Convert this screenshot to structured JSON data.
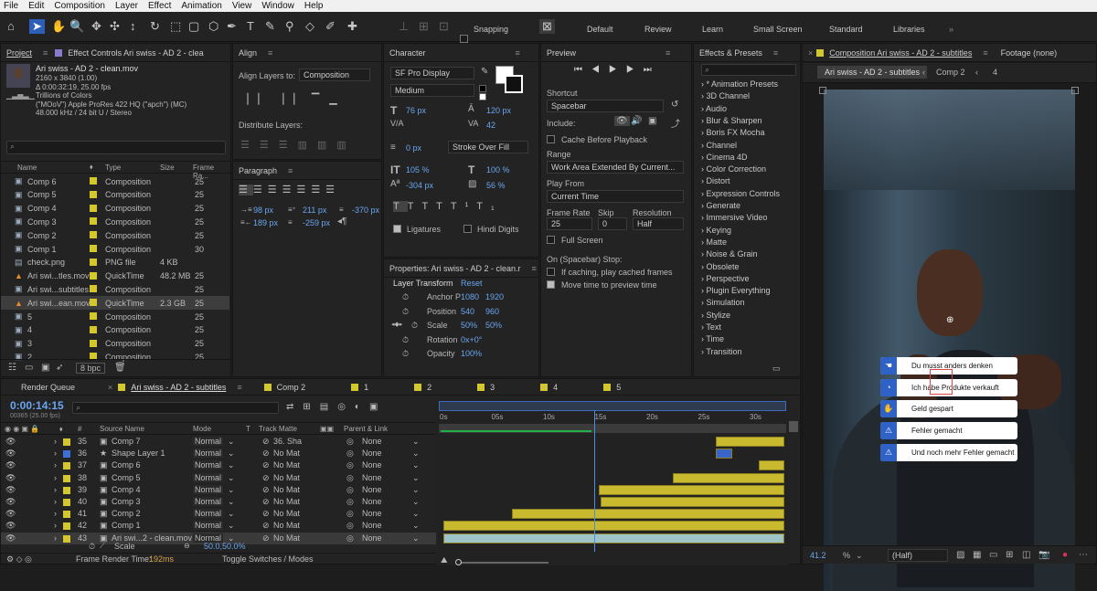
{
  "menu": [
    "File",
    "Edit",
    "Composition",
    "Layer",
    "Effect",
    "Animation",
    "View",
    "Window",
    "Help"
  ],
  "toolbar": {
    "snapping": "Snapping",
    "workspaces": [
      "Default",
      "Review",
      "Learn",
      "Small Screen",
      "Standard",
      "Libraries"
    ]
  },
  "project": {
    "tab": "Project",
    "tab2": "Effect Controls Ari swiss - AD 2 - clea",
    "file_name": "Ari swiss - AD 2 - clean.mov",
    "file_info": [
      "2160 x 3840 (1.00)",
      "Δ 0:00:32:19, 25.00 fps",
      "Trillions of Colors",
      "(\"MOoV\") Apple ProRes 422 HQ (\"apch\") (MC)",
      "48.000 kHz / 24 bit U / Stereo"
    ],
    "search_placeholder": "⌕",
    "headers": [
      "Name",
      "Type",
      "Size",
      "Frame Ra..."
    ],
    "rows": [
      {
        "name": "Comp 6",
        "type": "Composition",
        "size": "",
        "fr": "25"
      },
      {
        "name": "Comp 5",
        "type": "Composition",
        "size": "",
        "fr": "25"
      },
      {
        "name": "Comp 4",
        "type": "Composition",
        "size": "",
        "fr": "25"
      },
      {
        "name": "Comp 3",
        "type": "Composition",
        "size": "",
        "fr": "25"
      },
      {
        "name": "Comp 2",
        "type": "Composition",
        "size": "",
        "fr": "25"
      },
      {
        "name": "Comp 1",
        "type": "Composition",
        "size": "",
        "fr": "30"
      },
      {
        "name": "check.png",
        "type": "PNG file",
        "size": "4 KB",
        "fr": ""
      },
      {
        "name": "Ari swi...tles.mov",
        "type": "QuickTime",
        "size": "48.2 MB",
        "fr": "25"
      },
      {
        "name": "Ari swi...subtitles",
        "type": "Composition",
        "size": "",
        "fr": "25"
      },
      {
        "name": "Ari swi...ean.mov",
        "type": "QuickTime",
        "size": "2.3 GB",
        "fr": "25"
      },
      {
        "name": "5",
        "type": "Composition",
        "size": "",
        "fr": "25"
      },
      {
        "name": "4",
        "type": "Composition",
        "size": "",
        "fr": "25"
      },
      {
        "name": "3",
        "type": "Composition",
        "size": "",
        "fr": "25"
      },
      {
        "name": "2",
        "type": "Composition",
        "size": "",
        "fr": "25"
      }
    ],
    "bpc": "8 bpc"
  },
  "align": {
    "title": "Align",
    "align_to_label": "Align Layers to:",
    "align_to": "Composition",
    "distribute": "Distribute Layers:"
  },
  "paragraph": {
    "title": "Paragraph",
    "v1": "98 px",
    "v2": "211 px",
    "v3": "-370 px",
    "v4": "189 px",
    "v5": "-259 px"
  },
  "character": {
    "title": "Character",
    "font": "SF Pro Display",
    "style": "Medium",
    "size": "76 px",
    "leading": "120 px",
    "kerning": "",
    "tracking": "42",
    "stroke": "0 px",
    "stroke_mode": "Stroke Over Fill",
    "vscale": "105 %",
    "hscale": "100 %",
    "baseline": "-304 px",
    "tsume": "56 %",
    "ligatures": "Ligatures",
    "hindi": "Hindi Digits"
  },
  "properties": {
    "title": "Properties: Ari swiss - AD 2 - clean.r",
    "section": "Layer Transform",
    "reset": "Reset",
    "anchor_label": "Anchor P",
    "anchor": [
      "1080",
      "1920"
    ],
    "position_label": "Position",
    "position": [
      "540",
      "960"
    ],
    "scale_label": "Scale",
    "scale": [
      "50%",
      "50%"
    ],
    "rotation_label": "Rotation",
    "rotation": "0x+0°",
    "opacity_label": "Opacity",
    "opacity": "100%"
  },
  "preview": {
    "title": "Preview",
    "shortcut_label": "Shortcut",
    "shortcut": "Spacebar",
    "include": "Include:",
    "cache": "Cache Before Playback",
    "range_label": "Range",
    "range": "Work Area Extended By Current...",
    "play_from_label": "Play From",
    "play_from": "Current Time",
    "fr_label": "Frame Rate",
    "skip_label": "Skip",
    "res_label": "Resolution",
    "fr": "25",
    "skip": "0",
    "res": "Half",
    "full_screen": "Full Screen",
    "stop_label": "On (Spacebar) Stop:",
    "stop1": "If caching, play cached frames",
    "stop2": "Move time to preview time"
  },
  "effects": {
    "title": "Effects & Presets",
    "items": [
      "* Animation Presets",
      "3D Channel",
      "Audio",
      "Blur & Sharpen",
      "Boris FX Mocha",
      "Channel",
      "Cinema 4D",
      "Color Correction",
      "Distort",
      "Expression Controls",
      "Generate",
      "Immersive Video",
      "Keying",
      "Matte",
      "Noise & Grain",
      "Obsolete",
      "Perspective",
      "Plugin Everything",
      "Simulation",
      "Stylize",
      "Text",
      "Time",
      "Transition"
    ]
  },
  "comp": {
    "title": "Composition Ari swiss - AD 2 - subtitles",
    "footage": "Footage (none)",
    "tab_active": "Ari swiss - AD 2 - subtitles",
    "tab2": "Comp 2",
    "tab3": "4",
    "zoom": "41.2",
    "res": "(Half)",
    "cards": [
      "Du musst anders denken",
      "Ich habe Produkte verkauft",
      "Geld gespart",
      "Fehler gemacht",
      "Und noch mehr Fehler gemacht"
    ]
  },
  "timeline": {
    "render_queue": "Render Queue",
    "active_tab": "Ari swiss - AD 2 - subtitles",
    "tabs": [
      "Comp 2",
      "1",
      "2",
      "3",
      "4",
      "5"
    ],
    "time": "0:00:14:15",
    "frames": "00365 (25.00 fps)",
    "headers": {
      "source": "Source Name",
      "mode": "Mode",
      "t": "T",
      "matte": "Track Matte",
      "parent": "Parent & Link"
    },
    "ruler": [
      "0s",
      "05s",
      "10s",
      "15s",
      "20s",
      "25s",
      "30s"
    ],
    "layers": [
      {
        "num": "35",
        "name": "Comp 7",
        "mode": "Normal",
        "matte": "36. Sha",
        "parent": "None"
      },
      {
        "num": "36",
        "name": "Shape Layer 1",
        "mode": "Normal",
        "matte": "No Mat",
        "parent": "None"
      },
      {
        "num": "37",
        "name": "Comp 6",
        "mode": "Normal",
        "matte": "No Mat",
        "parent": "None"
      },
      {
        "num": "38",
        "name": "Comp 5",
        "mode": "Normal",
        "matte": "No Mat",
        "parent": "None"
      },
      {
        "num": "39",
        "name": "Comp 4",
        "mode": "Normal",
        "matte": "No Mat",
        "parent": "None"
      },
      {
        "num": "40",
        "name": "Comp 3",
        "mode": "Normal",
        "matte": "No Mat",
        "parent": "None"
      },
      {
        "num": "41",
        "name": "Comp 2",
        "mode": "Normal",
        "matte": "No Mat",
        "parent": "None"
      },
      {
        "num": "42",
        "name": "Comp 1",
        "mode": "Normal",
        "matte": "No Mat",
        "parent": "None"
      },
      {
        "num": "43",
        "name": "Ari swi...2 - clean.mov",
        "mode": "Normal",
        "matte": "No Mat",
        "parent": "None"
      }
    ],
    "scale_label": "Scale",
    "scale_value": "50.0,50.0%",
    "render_time_label": "Frame Render Time:",
    "render_time": "192ms",
    "toggle": "Toggle Switches / Modes"
  }
}
